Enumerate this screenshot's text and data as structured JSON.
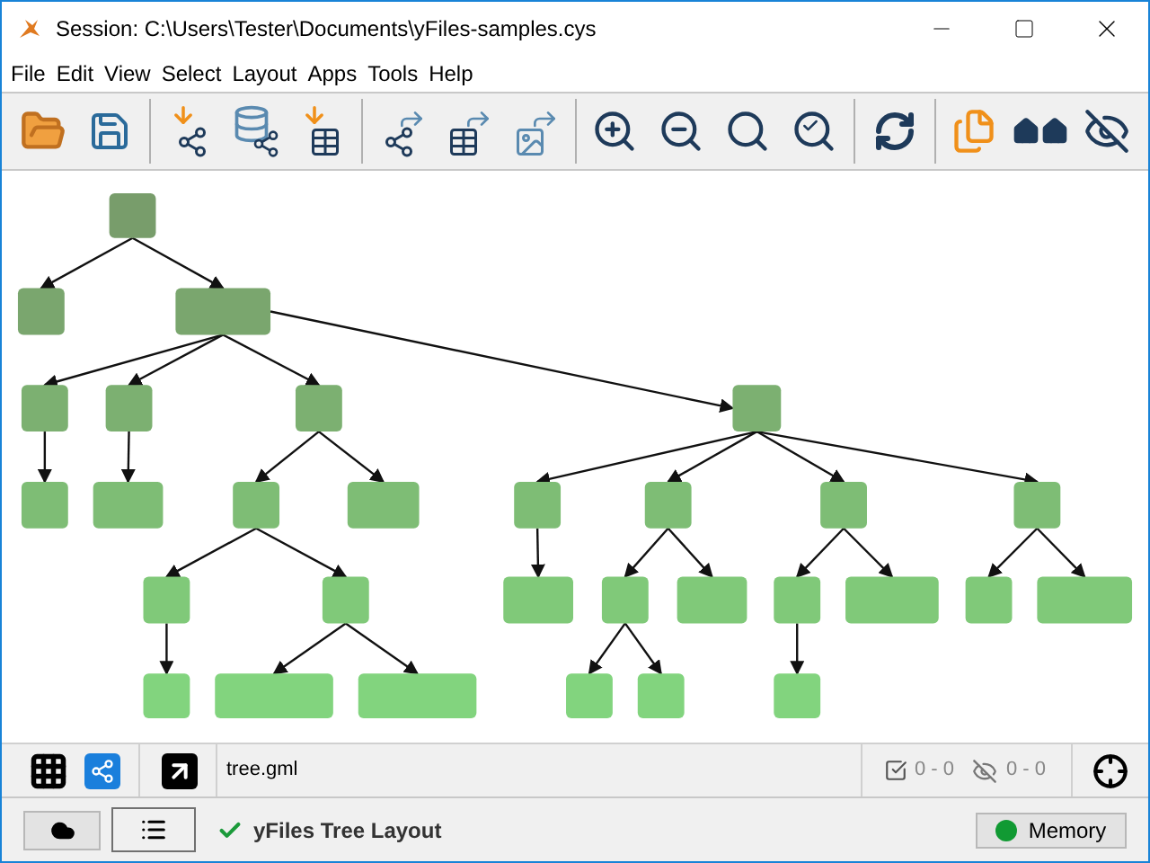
{
  "window": {
    "title": "Session: C:\\Users\\Tester\\Documents\\yFiles-samples.cys"
  },
  "menu": [
    "File",
    "Edit",
    "View",
    "Select",
    "Layout",
    "Apps",
    "Tools",
    "Help"
  ],
  "network_bar": {
    "file": "tree.gml",
    "selected_count": "0 - 0",
    "hidden_count": "0 - 0"
  },
  "status_bar": {
    "task": "yFiles Tree Layout",
    "memory": "Memory"
  }
}
